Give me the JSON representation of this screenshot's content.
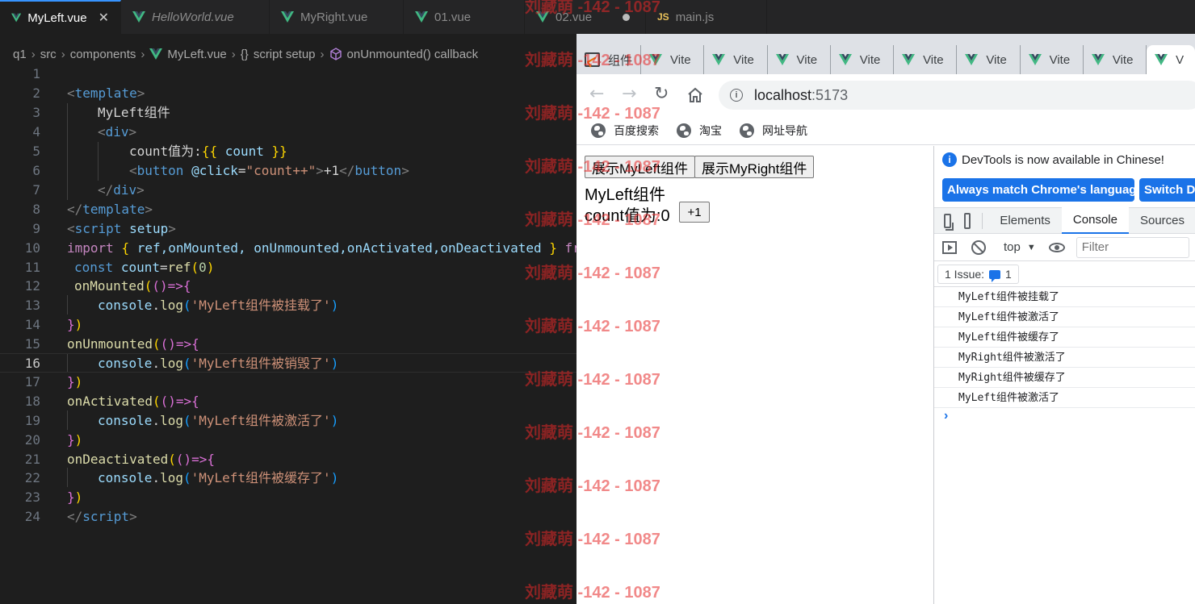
{
  "editor_tabs": [
    {
      "label": "MyLeft.vue",
      "icon": "vue-icon",
      "active": true
    },
    {
      "label": "HelloWorld.vue",
      "icon": "vue-icon"
    },
    {
      "label": "MyRight.vue",
      "icon": "vue-icon"
    },
    {
      "label": "01.vue",
      "icon": "vue-icon"
    },
    {
      "label": "02.vue",
      "icon": "vue-icon",
      "modified": true
    },
    {
      "label": "main.js",
      "icon": "js-icon",
      "js": "JS"
    }
  ],
  "breadcrumb": [
    "q1",
    "src",
    "components",
    "MyLeft.vue",
    "script setup",
    "onUnmounted() callback"
  ],
  "breadcrumb_glyphs": {
    "braces": "{}"
  },
  "line_numbers": [
    "1",
    "2",
    "3",
    "4",
    "5",
    "6",
    "7",
    "8",
    "9",
    "10",
    "11",
    "12",
    "13",
    "14",
    "15",
    "16",
    "17",
    "18",
    "19",
    "20",
    "21",
    "22",
    "23",
    "24"
  ],
  "code": {
    "l2": "template",
    "l3": "MyLeft组件",
    "l4": "div",
    "l5a": "count值为:",
    "l5b": "{{ ",
    "l5c": "count",
    "l5d": " }}",
    "l6tag": "button",
    "l6attr": "@click",
    "l6val": "\"count++\"",
    "l6text": "+1",
    "l7": "div",
    "l8": "template",
    "l9a": "script",
    "l9b": "setup",
    "l10a": "import",
    "l10b": "{",
    "l10c": "ref,onMounted, onUnmounted,onActivated,onDeactivated",
    "l10d": "}",
    "l10e": "fr",
    "l11a": "const",
    "l11b": "count",
    "l11c": "=",
    "l11d": "ref",
    "l11e": "(",
    "l11f": "0",
    "l11g": ")",
    "l12fn": "onMounted",
    "l15fn": "onUnmounted",
    "l18fn": "onActivated",
    "l21fn": "onDeactivated",
    "console": "console",
    "log": "log",
    "arrow": "()=>",
    "l13str": "'MyLeft组件被挂载了'",
    "l16str": "'MyLeft组件被销毁了'",
    "l19str": "'MyLeft组件被激活了'",
    "l22str": "'MyLeft组件被缓存了'",
    "l24": "script"
  },
  "browser": {
    "tabs": [
      "组件",
      "Vite",
      "Vite",
      "Vite",
      "Vite",
      "Vite",
      "Vite",
      "Vite",
      "Vite",
      "V"
    ],
    "url_host": "localhost",
    "url_port": ":5173",
    "bookmarks": [
      "百度搜索",
      "淘宝",
      "网址导航"
    ],
    "page": {
      "btn_left": "展示MyLeft组件",
      "btn_right": "展示MyRight组件",
      "title": "MyLeft组件",
      "count_label": "count值为:0",
      "plus_btn": "+1"
    }
  },
  "devtools": {
    "banner": "DevTools is now available in Chinese!",
    "btn_match": "Always match Chrome's language",
    "btn_switch": "Switch De",
    "tabs": [
      "Elements",
      "Console",
      "Sources"
    ],
    "context": "top",
    "filter_placeholder": "Filter",
    "issues_label": "1 Issue:",
    "issues_count": "1",
    "logs": [
      "MyLeft组件被挂载了",
      "MyLeft组件被激活了",
      "MyLeft组件被缓存了",
      "MyRight组件被激活了",
      "MyRight组件被缓存了",
      "MyLeft组件被激活了"
    ]
  },
  "watermark": "刘藏萌 -142 - 1087",
  "colors": {
    "accent": "#1a73e8",
    "editor_bg": "#1e1e1e",
    "vue_green": "#41b883"
  }
}
